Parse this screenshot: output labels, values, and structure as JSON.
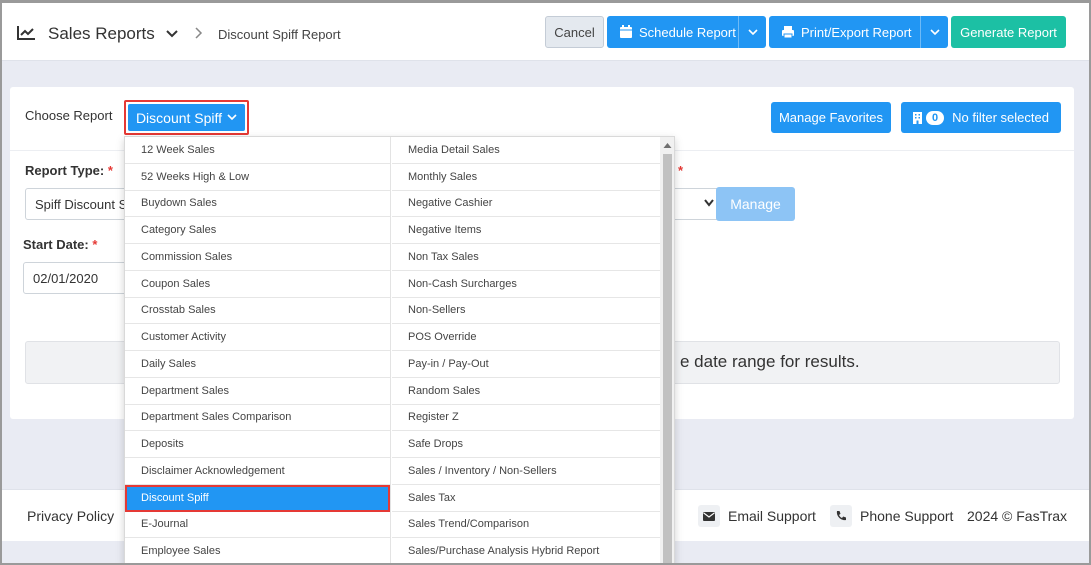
{
  "header": {
    "title": "Sales Reports",
    "breadcrumb": "Discount Spiff Report",
    "cancel_label": "Cancel",
    "schedule_label": "Schedule Report",
    "print_label": "Print/Export Report",
    "generate_label": "Generate Report"
  },
  "toolbar": {
    "choose_label": "Choose Report",
    "selected_report": "Discount Spiff",
    "favorites_label": "Manage Favorites",
    "filter_count": "0",
    "filter_label": "No filter selected"
  },
  "form": {
    "report_type_label": "Report Type:",
    "report_type_value": "Spiff Discount Su",
    "required_mark": "*",
    "manage_label": "Manage",
    "start_date_label": "Start Date:",
    "start_date_value": "02/01/2020",
    "message": "e date range for results."
  },
  "footer": {
    "privacy": "Privacy Policy",
    "email": "Email Support",
    "phone": "Phone Support",
    "copyright": "2024 © FasTrax"
  },
  "dropdown": {
    "column1": [
      "12 Week Sales",
      "52 Weeks High & Low",
      "Buydown Sales",
      "Category Sales",
      "Commission Sales",
      "Coupon Sales",
      "Crosstab Sales",
      "Customer Activity",
      "Daily Sales",
      "Department Sales",
      "Department Sales Comparison",
      "Deposits",
      "Disclaimer Acknowledgement",
      "Discount Spiff",
      "E-Journal",
      "Employee Sales"
    ],
    "column2": [
      "Media Detail Sales",
      "Monthly Sales",
      "Negative Cashier",
      "Negative Items",
      "Non Tax Sales",
      "Non-Cash Surcharges",
      "Non-Sellers",
      "POS Override",
      "Pay-in / Pay-Out",
      "Random Sales",
      "Register Z",
      "Safe Drops",
      "Sales / Inventory / Non-Sellers",
      "Sales Tax",
      "Sales Trend/Comparison",
      "Sales/Purchase Analysis Hybrid Report"
    ],
    "active_item": "Discount Spiff"
  },
  "colors": {
    "primary": "#2196f3",
    "generate": "#1cc0a4",
    "highlight": "#e53935"
  }
}
